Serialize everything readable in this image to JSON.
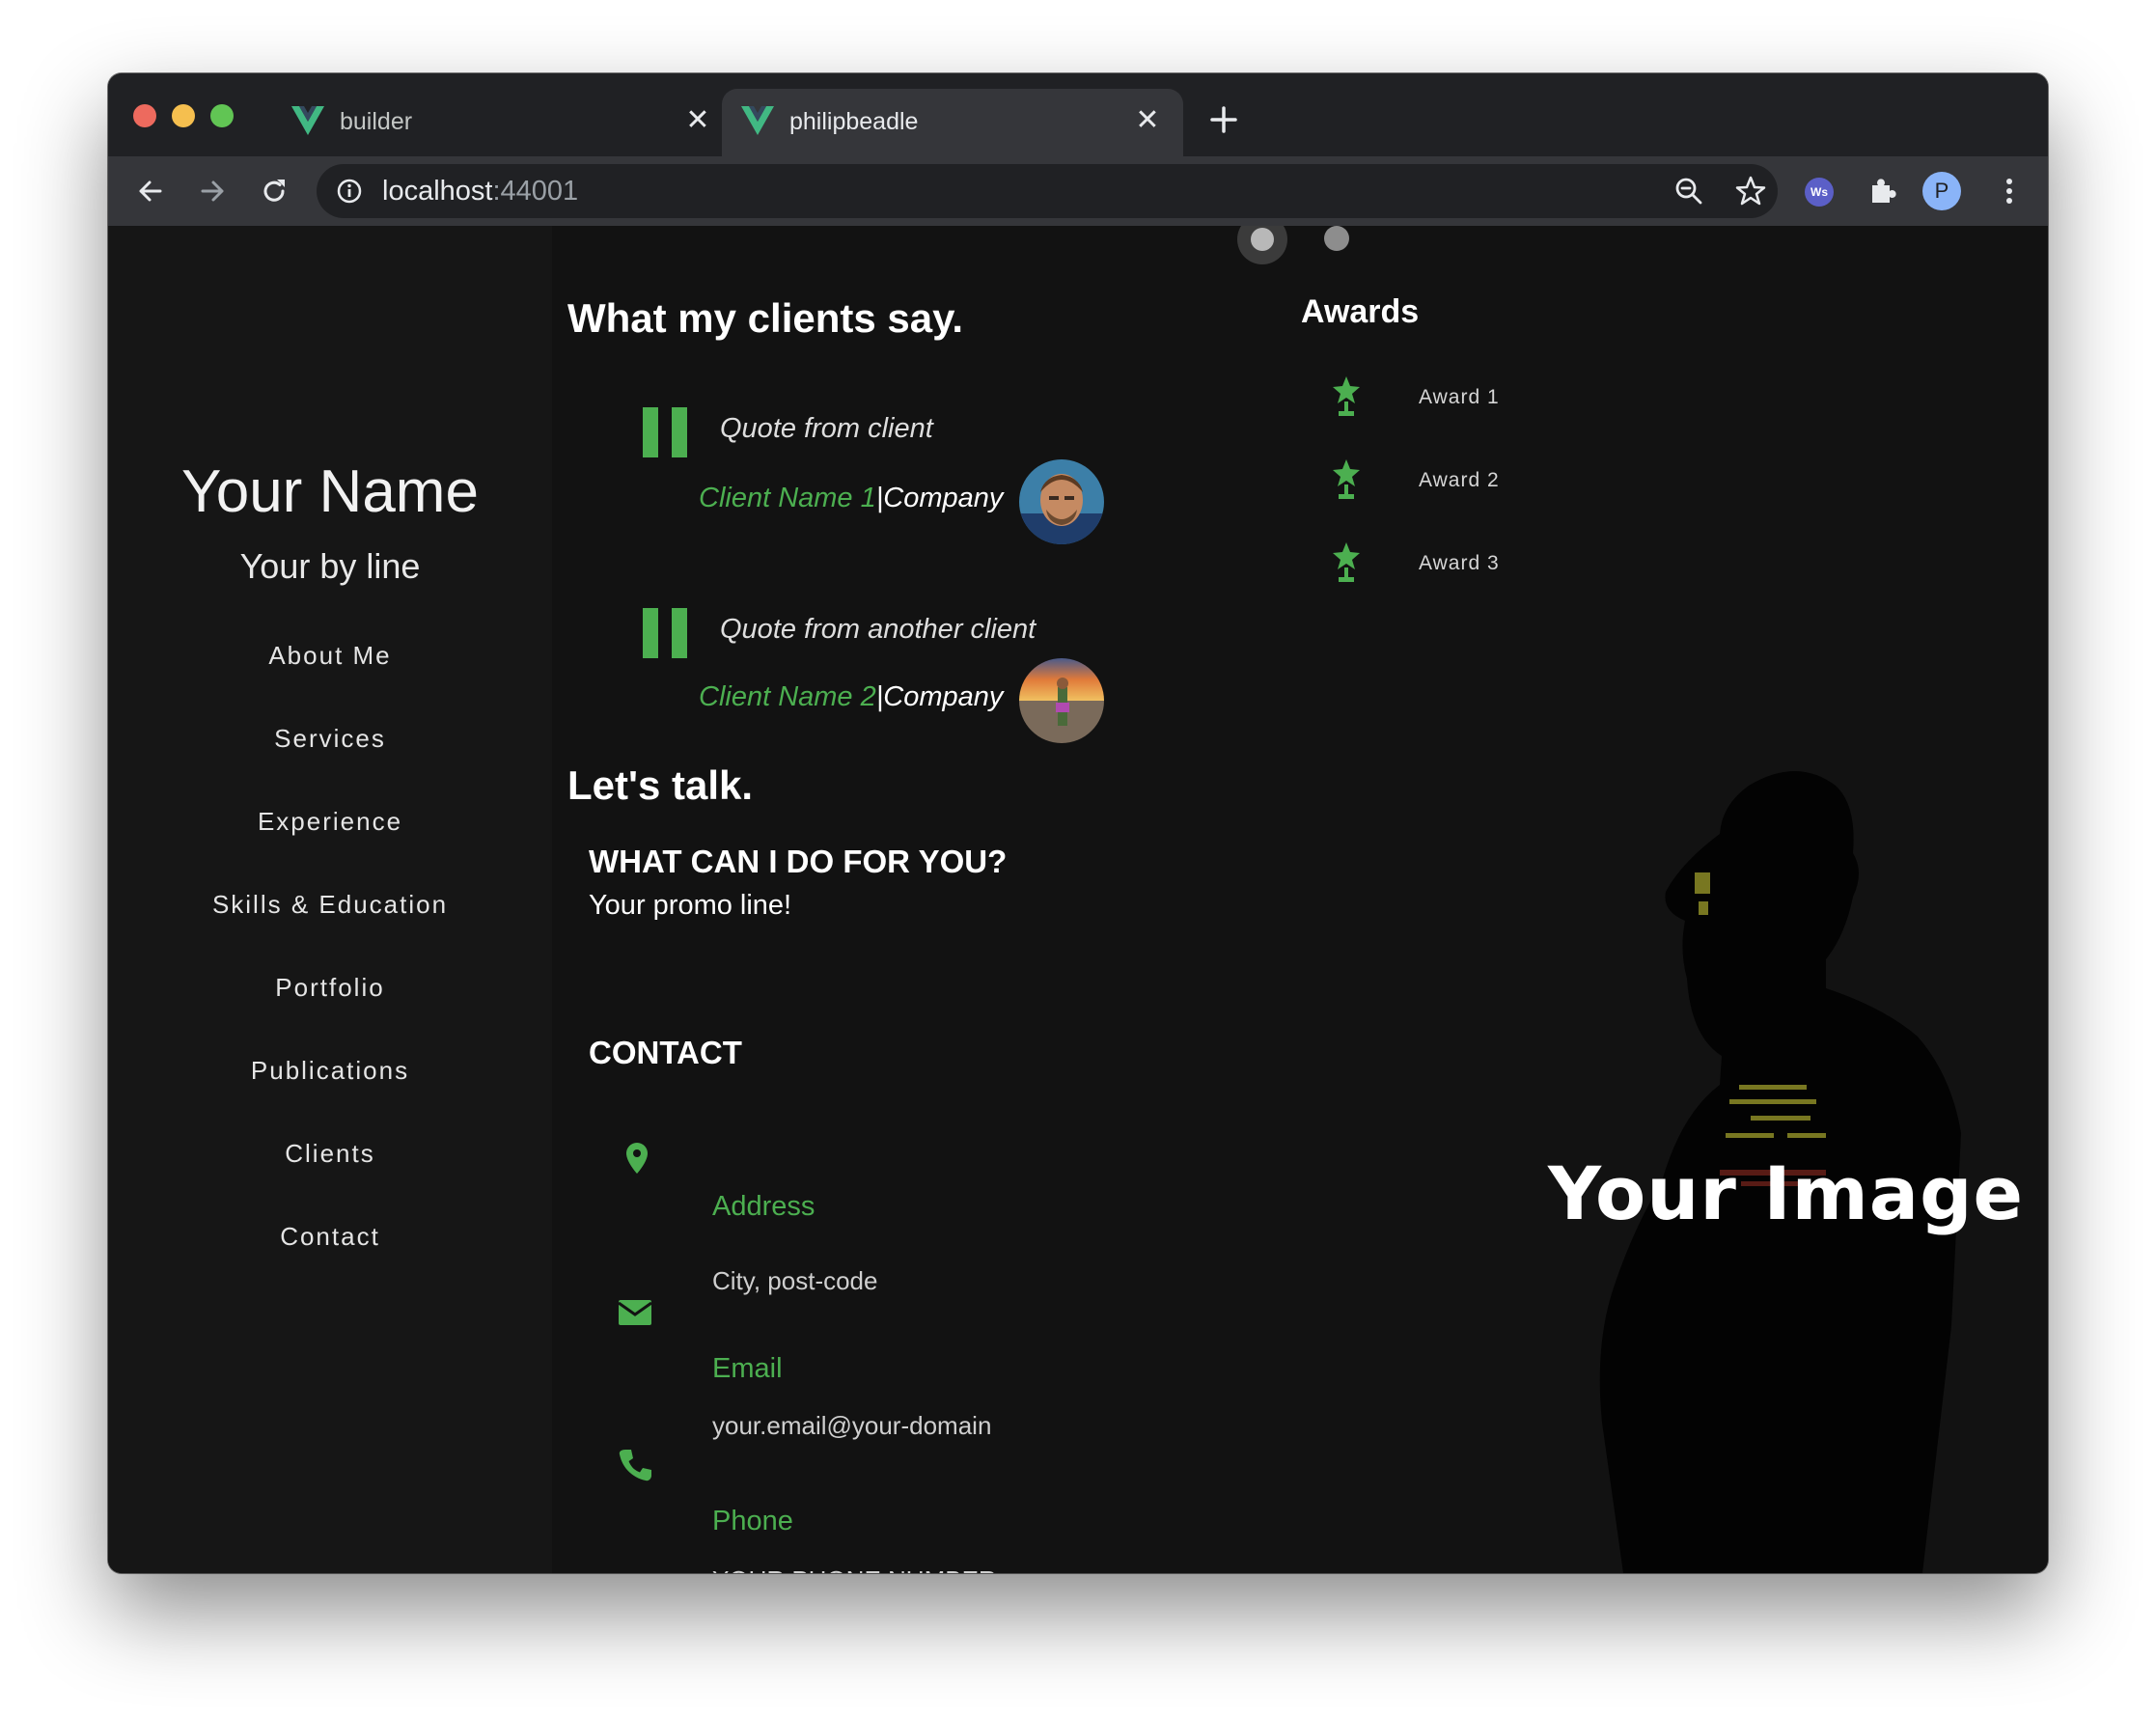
{
  "browser": {
    "tabs": [
      {
        "title": "builder",
        "favicon": "vue-logo-icon",
        "active": false
      },
      {
        "title": "philipbeadle",
        "favicon": "vue-logo-icon",
        "active": true
      }
    ],
    "url_host": "localhost",
    "url_port": ":44001"
  },
  "sidebar": {
    "name": "Your Name",
    "byline": "Your by line",
    "nav": [
      "About Me",
      "Services",
      "Experience",
      "Skills & Education",
      "Portfolio",
      "Publications",
      "Clients",
      "Contact"
    ]
  },
  "clients": {
    "heading": "What my clients say.",
    "testimonials": [
      {
        "quote": "Quote from client",
        "name": "Client Name 1",
        "company": "|Company"
      },
      {
        "quote": "Quote from another client",
        "name": "Client Name 2",
        "company": "|Company"
      }
    ]
  },
  "contact": {
    "heading": "Let's talk.",
    "promo_heading": "WHAT CAN I DO FOR YOU?",
    "promo_line": "Your promo line!",
    "contact_heading": "CONTACT",
    "items": [
      {
        "label": "Address",
        "value": "City, post-code",
        "icon": "location-pin-icon"
      },
      {
        "label": "Email",
        "value": "your.email@your-domain",
        "icon": "email-icon"
      },
      {
        "label": "Phone",
        "value": "YOUR PHONE NUMBER",
        "icon": "phone-icon"
      }
    ]
  },
  "awards": {
    "heading": "Awards",
    "items": [
      "Award 1",
      "Award 2",
      "Award 3"
    ]
  },
  "hero": {
    "caption": "Your Image"
  },
  "colors": {
    "accent": "#4caf50",
    "page_bg": "#121212",
    "sidebar_bg": "#161616"
  }
}
